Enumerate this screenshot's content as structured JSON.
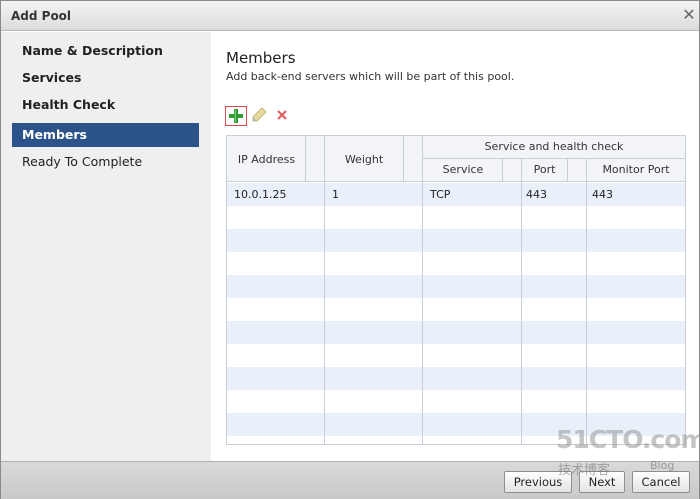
{
  "window": {
    "title": "Add Pool",
    "close_glyph": "✕"
  },
  "nav": {
    "items": [
      {
        "label": "Name & Description",
        "state": "done"
      },
      {
        "label": "Services",
        "state": "done"
      },
      {
        "label": "Health Check",
        "state": "done"
      },
      {
        "label": "Members",
        "state": "active"
      },
      {
        "label": "Ready To Complete",
        "state": "pending"
      }
    ]
  },
  "main": {
    "heading": "Members",
    "subtext": "Add back-end servers which will be part of this pool."
  },
  "toolbar": {
    "add_icon": "plus-icon",
    "edit_icon": "pencil-icon",
    "delete_icon": "x-icon"
  },
  "table": {
    "headers": {
      "ip": "IP Address",
      "weight": "Weight",
      "group": "Service and health check",
      "service": "Service",
      "port": "Port",
      "monitor_port": "Monitor Port"
    },
    "rows": [
      {
        "ip": "10.0.1.25",
        "weight": "1",
        "service": "TCP",
        "port": "443",
        "monitor_port": "443"
      }
    ]
  },
  "footer": {
    "previous": "Previous",
    "next": "Next",
    "cancel": "Cancel"
  },
  "watermark": {
    "brand": "51CTO.com",
    "cn": "技术博客",
    "blog": "Blog"
  },
  "colors": {
    "accent": "#2b5389",
    "add_green": "#2e9c2e",
    "delete_red": "#e06060"
  }
}
